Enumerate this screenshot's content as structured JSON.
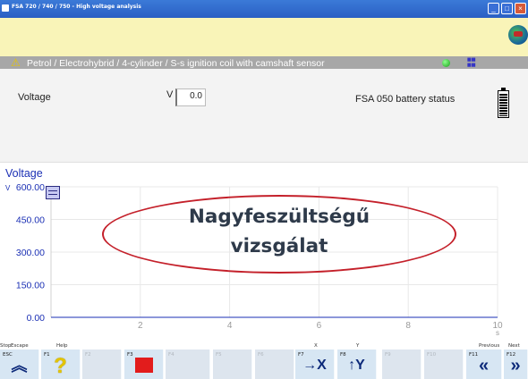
{
  "window": {
    "title": "FSA 720 / 740 / 750 - High voltage analysis",
    "controls": [
      "_",
      "□",
      "×"
    ]
  },
  "path": {
    "text": "Petrol / Electrohybrid /  4-cylinder / S-s ignition coil with camshaft sensor",
    "warning_icon": "warning-triangle",
    "net_icon": "network-status-icon"
  },
  "measure": {
    "label": "Voltage",
    "unit": "V",
    "value": "0.0",
    "battery_label": "FSA 050 battery status",
    "battery_level": 0.85
  },
  "chart_data": {
    "type": "line",
    "title": "Voltage",
    "ylabel": "V",
    "xlabel": "s",
    "ylim": [
      0,
      600
    ],
    "xlim": [
      0,
      10
    ],
    "yticks": [
      "0.00",
      "150.00",
      "300.00",
      "450.00",
      "600.00"
    ],
    "xticks": [
      "2",
      "4",
      "6",
      "8",
      "10"
    ],
    "grid": true,
    "series": []
  },
  "overlay": {
    "line1": "Nagyfeszültségű",
    "line2": "vizsgálat"
  },
  "fkeys": [
    {
      "label": "Escape",
      "key": "ESC",
      "icon": "double-up-icon",
      "glyph": "⏶",
      "enabled": true
    },
    {
      "label": "Help",
      "key": "F1",
      "icon": "question-icon",
      "glyph": "?",
      "enabled": true
    },
    {
      "label": "",
      "key": "F2",
      "icon": "",
      "glyph": "",
      "enabled": false
    },
    {
      "label": "Stop",
      "key": "F3",
      "icon": "stop-icon",
      "glyph": "",
      "enabled": true
    },
    {
      "label": "",
      "key": "F4",
      "icon": "",
      "glyph": "",
      "enabled": false
    },
    {
      "label": "",
      "key": "F5",
      "icon": "",
      "glyph": "",
      "enabled": false
    },
    {
      "label": "",
      "key": "F6",
      "icon": "",
      "glyph": "",
      "enabled": false
    },
    {
      "label": "X",
      "key": "F7",
      "icon": "arrow-x-icon",
      "glyph": "→X",
      "enabled": true
    },
    {
      "label": "Y",
      "key": "F8",
      "icon": "arrow-y-icon",
      "glyph": "↑Y",
      "enabled": true
    },
    {
      "label": "",
      "key": "F9",
      "icon": "",
      "glyph": "",
      "enabled": false
    },
    {
      "label": "",
      "key": "F10",
      "icon": "",
      "glyph": "",
      "enabled": false
    },
    {
      "label": "Previous",
      "key": "F11",
      "icon": "double-left-icon",
      "glyph": "«",
      "enabled": true
    },
    {
      "label": "Next",
      "key": "F12",
      "icon": "double-right-icon",
      "glyph": "»",
      "enabled": true
    }
  ]
}
